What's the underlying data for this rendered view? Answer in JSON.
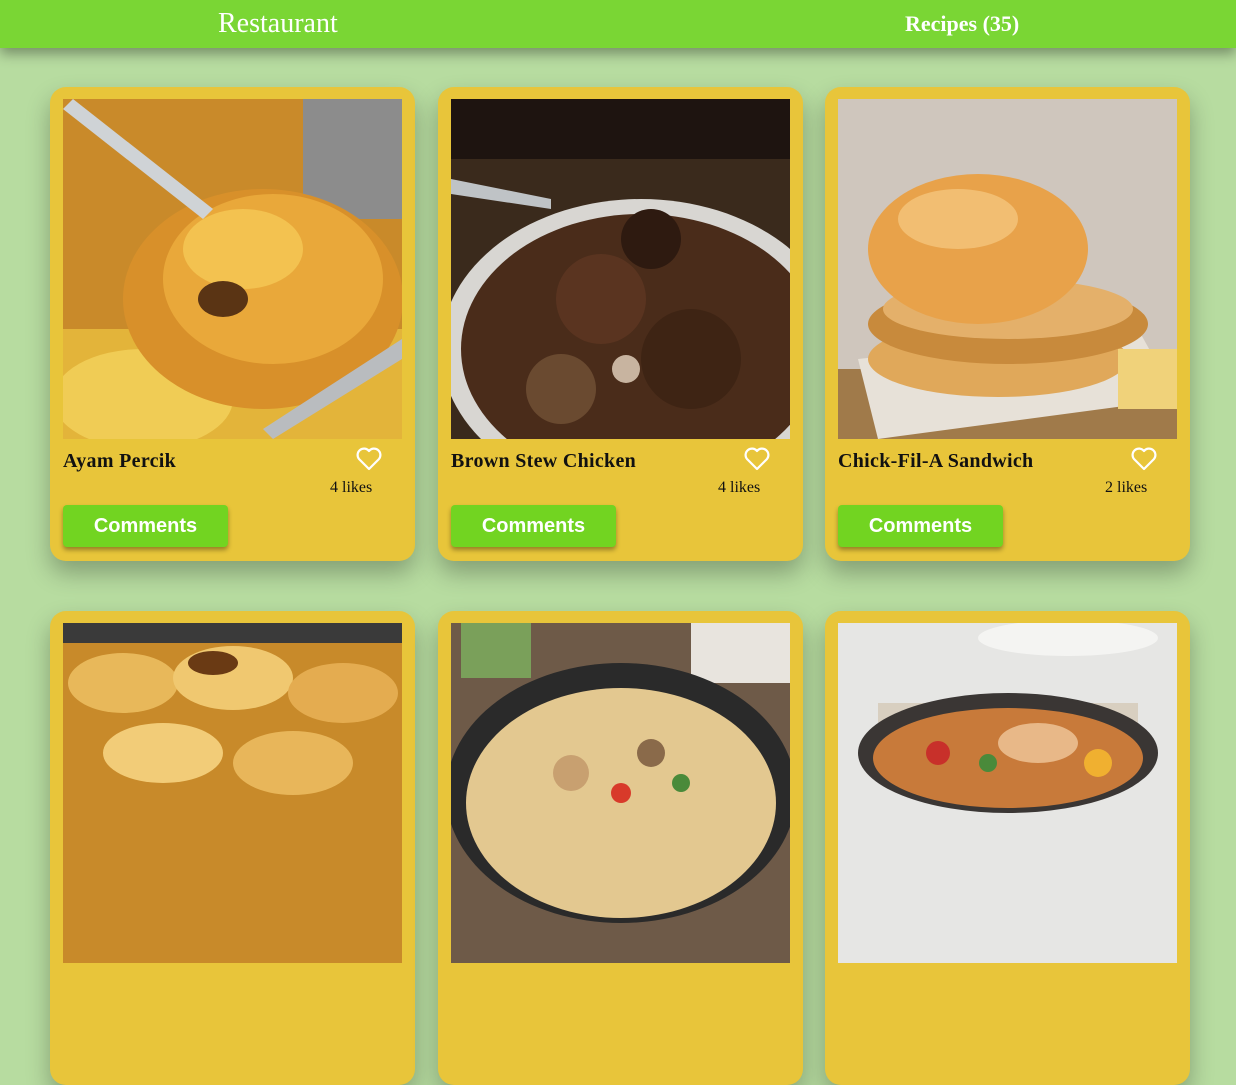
{
  "header": {
    "brand": "Restaurant",
    "recipes_link": "Recipes (35)"
  },
  "colors": {
    "header_bg": "#7ad634",
    "page_bg": "#b7dca0",
    "card_bg": "#e8c53a",
    "button_bg": "#72d421"
  },
  "recipes": [
    {
      "title": "Ayam Percik",
      "likes": "4 likes",
      "comments_label": "Comments",
      "image": "grilled-chicken-photo"
    },
    {
      "title": "Brown Stew Chicken",
      "likes": "4 likes",
      "comments_label": "Comments",
      "image": "stew-chicken-photo"
    },
    {
      "title": "Chick-Fil-A Sandwich",
      "likes": "2 likes",
      "comments_label": "Comments",
      "image": "chicken-sandwich-photo"
    },
    {
      "title": "",
      "likes": "",
      "comments_label": "",
      "image": "potato-gratin-photo"
    },
    {
      "title": "",
      "likes": "",
      "comments_label": "",
      "image": "pasta-skillet-photo"
    },
    {
      "title": "",
      "likes": "",
      "comments_label": "",
      "image": "chicken-paella-photo"
    }
  ]
}
